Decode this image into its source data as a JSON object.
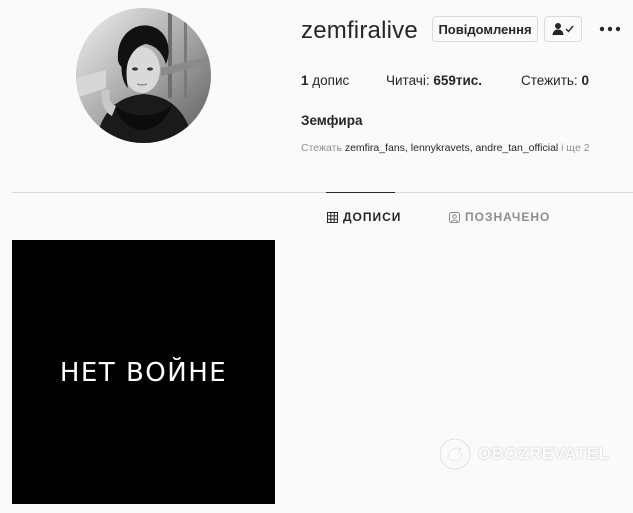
{
  "profile": {
    "username": "zemfiralive",
    "message_button": "Повідомлення",
    "stats": {
      "posts_count": "1",
      "posts_label": " допис",
      "followers_label": "Читачі: ",
      "followers_count": "659тис.",
      "following_label": "Стежить: ",
      "following_count": "0"
    },
    "full_name": "Земфира",
    "followed_by": {
      "prefix": "Стежать ",
      "names": "zemfira_fans, lennykravets, andre_tan_official",
      "suffix": " і ще 2"
    }
  },
  "tabs": [
    {
      "label": "ДОПИСИ",
      "icon": "grid-icon",
      "active": true
    },
    {
      "label": "ПОЗНАЧЕНО",
      "icon": "tagged-icon",
      "active": false
    }
  ],
  "posts": [
    {
      "text": "НЕТ ВОЙНЕ"
    }
  ],
  "watermark": {
    "text": "OBOZREVATEL"
  },
  "colors": {
    "background": "#fafafa",
    "text": "#262626",
    "muted": "#8e8e8e",
    "border": "#dbdbdb",
    "post_background": "#000000"
  }
}
